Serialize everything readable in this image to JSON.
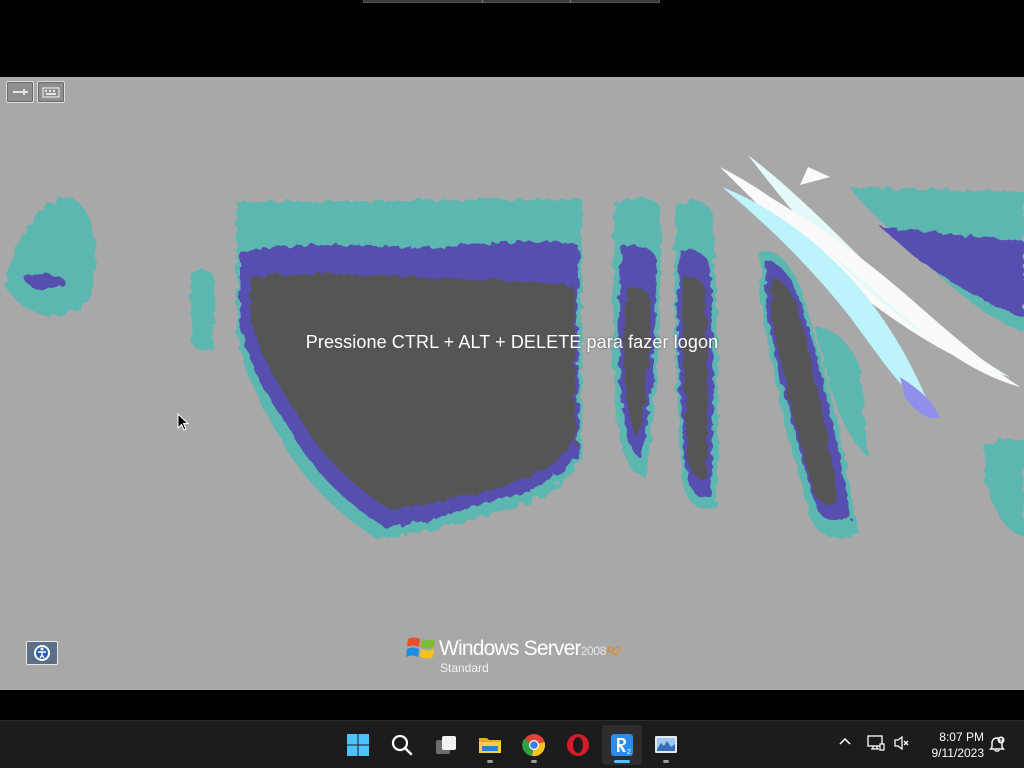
{
  "remote_session": {
    "logon_prompt": "Pressione CTRL + ALT + DELETE para fazer logon",
    "brand": {
      "product": "Windows Server",
      "version": "2008",
      "release": "R2",
      "edition": "Standard"
    },
    "icons": {
      "pin": "pin-icon",
      "keyboard": "keyboard-icon",
      "ease_of_access": "ease-of-access-icon",
      "logo": "windows-flag-logo"
    }
  },
  "taskbar": {
    "items": [
      {
        "name": "start-button",
        "icon": "windows-start-icon"
      },
      {
        "name": "search-button",
        "icon": "search-icon"
      },
      {
        "name": "task-view-button",
        "icon": "task-view-icon"
      },
      {
        "name": "file-explorer-button",
        "icon": "folder-icon",
        "running": true
      },
      {
        "name": "chrome-button",
        "icon": "chrome-icon",
        "running": true
      },
      {
        "name": "opera-button",
        "icon": "opera-icon",
        "running": false
      },
      {
        "name": "rdp-client-button",
        "icon": "remote-desktop-icon",
        "running": true,
        "active": true
      },
      {
        "name": "monitor-app-button",
        "icon": "resource-monitor-icon",
        "running": true
      }
    ],
    "tray": {
      "time": "8:07 PM",
      "date": "9/11/2023",
      "icons": [
        "chevron-up-icon",
        "network-icon",
        "volume-muted-icon",
        "notifications-icon"
      ]
    }
  },
  "colors": {
    "remote_background": "#a8a8a8",
    "teal": "#5bb7b0",
    "indigo": "#5650b0",
    "dark": "#555555",
    "accent_active": "#4cc2ff",
    "brand_r2": "#e08a20"
  }
}
